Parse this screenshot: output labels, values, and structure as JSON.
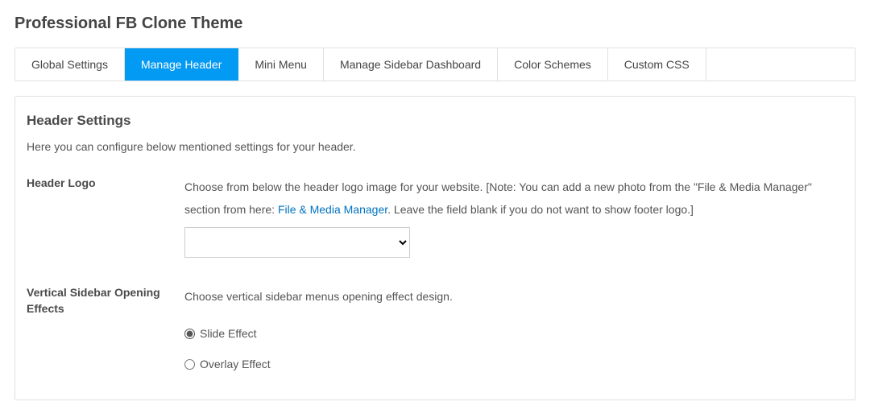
{
  "page": {
    "title": "Professional FB Clone Theme"
  },
  "tabs": {
    "global_settings": "Global Settings",
    "manage_header": "Manage Header",
    "mini_menu": "Mini Menu",
    "manage_sidebar": "Manage Sidebar Dashboard",
    "color_schemes": "Color Schemes",
    "custom_css": "Custom CSS"
  },
  "section": {
    "title": "Header Settings",
    "description": "Here you can configure below mentioned settings for your header."
  },
  "header_logo": {
    "label": "Header Logo",
    "desc_before_link": "Choose from below the header logo image for your website. [Note: You can add a new photo from the \"File & Media Manager\" section from here: ",
    "link_text": "File & Media Manager",
    "desc_after_link": ". Leave the field blank if you do not want to show footer logo.]",
    "select_value": ""
  },
  "sidebar_effects": {
    "label": "Vertical Sidebar Opening Effects",
    "description": "Choose vertical sidebar menus opening effect design.",
    "options": {
      "slide": "Slide Effect",
      "overlay": "Overlay Effect"
    },
    "selected": "slide"
  }
}
